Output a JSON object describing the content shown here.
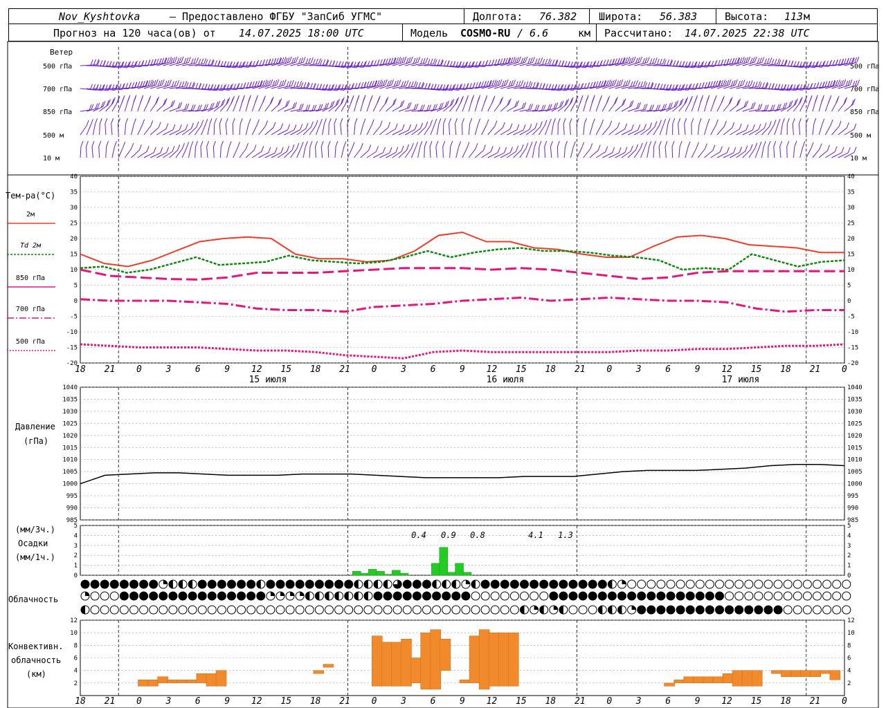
{
  "header": {
    "station": "Nov_Kyshtovka",
    "provider": "— Предоставлено ФГБУ \"ЗапСиб УГМС\"",
    "lon_label": "Долгота:",
    "lon": "76.382",
    "lat_label": "Широта:",
    "lat": "56.383",
    "alt_label": "Высота:",
    "alt": "113",
    "alt_unit": "м",
    "forecast_label": "Прогноз на 120 часа(ов) от",
    "forecast_time": "14.07.2025 18:00 UTC",
    "model_label": "Модель",
    "model": "COSMO-RU",
    "model_res": "/ 6.6",
    "model_res_unit": "км",
    "calc_label": "Рассчитано:",
    "calc_time": "14.07.2025 22:38 UTC"
  },
  "labels": {
    "wind_title": "Ветер",
    "wind_levels": [
      "500 гПа",
      "700 гПа",
      "850 гПа",
      "500 м",
      "10 м"
    ],
    "temp_title": "Тем-ра(°С)",
    "temp_legend": [
      "2м",
      "Td 2м",
      "850 гПа",
      "700 гПа",
      "500 гПа"
    ],
    "pressure_title": [
      "Давление",
      "(гПа)"
    ],
    "precip_title": [
      "(мм/3ч.)",
      "Осадки",
      "(мм/1ч.)"
    ],
    "cloud_title": "Облачность",
    "conv_title": [
      "Конвективн.",
      "облачность",
      "(км)"
    ],
    "day_labels": [
      "15 июля",
      "16 июля",
      "17 июля"
    ]
  },
  "chart_data": [
    {
      "type": "line",
      "title": "Тем-ра(°С)",
      "x_ticks": [
        "18",
        "21",
        "0",
        "3",
        "6",
        "9",
        "12",
        "15",
        "18",
        "21",
        "0",
        "3",
        "6",
        "9",
        "12",
        "15",
        "18",
        "21",
        "0",
        "3",
        "6",
        "9",
        "12",
        "15",
        "18",
        "21",
        "0"
      ],
      "ylim": [
        -20,
        40
      ],
      "yticks": [
        -20,
        -15,
        -10,
        -5,
        0,
        5,
        10,
        15,
        20,
        25,
        30,
        35,
        40
      ],
      "x_hours": [
        0,
        3,
        6,
        9,
        12,
        15,
        18,
        21,
        24,
        27,
        30,
        33,
        36,
        39,
        42,
        45,
        48,
        51,
        54,
        57,
        60,
        63,
        66,
        69,
        72,
        75,
        78
      ],
      "series": [
        {
          "name": "2м",
          "color": "#f03c28",
          "values": [
            15,
            12,
            11,
            13,
            16,
            19,
            20,
            20.5,
            20,
            15,
            13.5,
            13.5,
            12.5,
            13,
            16,
            21,
            22,
            19,
            19,
            17,
            16.5,
            15,
            14,
            14,
            17.5,
            20.5,
            21,
            20,
            18,
            17.5,
            17,
            15.5,
            15.5
          ]
        },
        {
          "name": "Td 2м",
          "color": "#0a8a0a",
          "values": [
            10.5,
            11,
            9,
            10,
            12,
            14,
            11.5,
            12,
            12.5,
            14.5,
            13,
            12.5,
            12,
            12.5,
            14,
            16,
            14,
            15.5,
            16.5,
            17,
            16,
            16,
            15.5,
            14.5,
            14,
            13,
            10,
            10.5,
            10,
            15,
            13,
            11,
            12.5,
            13
          ]
        },
        {
          "name": "850 гПа",
          "color": "#e6157e",
          "values": [
            10,
            8,
            7.5,
            7,
            6.8,
            7.5,
            9,
            9,
            9,
            9.5,
            10,
            10.5,
            10.5,
            10.5,
            10,
            10.5,
            10,
            9,
            8,
            7,
            7.5,
            9,
            9.5,
            9.5,
            9.5,
            9.5,
            9.5
          ]
        },
        {
          "name": "700 гПа",
          "color": "#e6157e",
          "values": [
            0.5,
            0,
            0,
            0,
            -0.5,
            -1,
            -2.5,
            -3,
            -3,
            -3.5,
            -2,
            -1.5,
            -1,
            0,
            0.5,
            1,
            0,
            0.5,
            1,
            0.5,
            0,
            0,
            -0.5,
            -2.5,
            -3.5,
            -3,
            -3
          ]
        },
        {
          "name": "500 гПа",
          "color": "#e6157e",
          "values": [
            -14,
            -14.5,
            -15,
            -15,
            -15,
            -15.5,
            -16,
            -16,
            -16.5,
            -17.5,
            -18,
            -18.5,
            -16.5,
            -16,
            -16.5,
            -16.5,
            -16.5,
            -16.5,
            -16.5,
            -16,
            -16,
            -15.5,
            -15.5,
            -15,
            -14.5,
            -14.5,
            -14
          ]
        }
      ]
    },
    {
      "type": "line",
      "title": "Давление (гПа)",
      "ylim": [
        985,
        1040
      ],
      "yticks": [
        985,
        990,
        995,
        1000,
        1005,
        1010,
        1015,
        1020,
        1025,
        1030,
        1035,
        1040
      ],
      "series": [
        {
          "name": "pressure",
          "color": "#000000",
          "values": [
            1000,
            1003.5,
            1004,
            1004.5,
            1004.5,
            1004,
            1003.5,
            1003.5,
            1003.5,
            1004,
            1004,
            1004,
            1003.5,
            1003,
            1002.5,
            1002.5,
            1002.5,
            1002.5,
            1003,
            1003,
            1003,
            1004,
            1005,
            1005.5,
            1005.5,
            1005.5,
            1006,
            1006.5,
            1007.5,
            1008,
            1008,
            1007.5
          ]
        }
      ]
    },
    {
      "type": "bar",
      "title": "Осадки",
      "ylim": [
        0,
        5
      ],
      "yticks": [
        0,
        1,
        2,
        3,
        4,
        5
      ],
      "bars_hour": [
        35,
        36,
        37,
        38,
        39,
        40,
        41,
        42,
        43,
        44,
        45,
        46,
        47,
        48,
        49
      ],
      "values": [
        0.4,
        0.2,
        0.6,
        0.4,
        0.1,
        0.5,
        0.2,
        0,
        0,
        0,
        1.2,
        2.8,
        0.3,
        1.2,
        0.3
      ],
      "sum_labels": [
        "0.4",
        "0.9",
        "0.8",
        "4.1",
        "1.3"
      ],
      "color": "#22cc22"
    },
    {
      "type": "bar",
      "title": "Конвективн. облачность (км)",
      "ylim": [
        0,
        12
      ],
      "yticks": [
        2,
        4,
        6,
        8,
        10,
        12
      ],
      "color": "#f08a2c",
      "segments": [
        {
          "h": 6,
          "base": 1.5,
          "top": 2.5
        },
        {
          "h": 7,
          "base": 1.5,
          "top": 2.5
        },
        {
          "h": 8,
          "base": 2,
          "top": 3
        },
        {
          "h": 9,
          "base": 2,
          "top": 2.5
        },
        {
          "h": 10,
          "base": 2,
          "top": 2.5
        },
        {
          "h": 11,
          "base": 2,
          "top": 2.5
        },
        {
          "h": 12,
          "base": 2,
          "top": 3.5
        },
        {
          "h": 13,
          "base": 1.5,
          "top": 3.5
        },
        {
          "h": 14,
          "base": 1.5,
          "top": 4
        },
        {
          "h": 24,
          "base": 3.5,
          "top": 4
        },
        {
          "h": 25,
          "base": 4.5,
          "top": 5
        },
        {
          "h": 30,
          "base": 1.5,
          "top": 9.5
        },
        {
          "h": 31,
          "base": 1.5,
          "top": 8.5
        },
        {
          "h": 32,
          "base": 1.5,
          "top": 8.5
        },
        {
          "h": 33,
          "base": 1.5,
          "top": 9
        },
        {
          "h": 34,
          "base": 2,
          "top": 6
        },
        {
          "h": 35,
          "base": 1,
          "top": 10
        },
        {
          "h": 36,
          "base": 1,
          "top": 10.5
        },
        {
          "h": 37,
          "base": 4,
          "top": 9
        },
        {
          "h": 39,
          "base": 2,
          "top": 2.5
        },
        {
          "h": 40,
          "base": 2,
          "top": 9.5
        },
        {
          "h": 41,
          "base": 1,
          "top": 10.5
        },
        {
          "h": 42,
          "base": 1.5,
          "top": 10
        },
        {
          "h": 43,
          "base": 1.5,
          "top": 10
        },
        {
          "h": 44,
          "base": 1.5,
          "top": 10
        },
        {
          "h": 60,
          "base": 1.5,
          "top": 2
        },
        {
          "h": 61,
          "base": 2,
          "top": 2.5
        },
        {
          "h": 62,
          "base": 2,
          "top": 3
        },
        {
          "h": 63,
          "base": 2,
          "top": 3
        },
        {
          "h": 64,
          "base": 2,
          "top": 3
        },
        {
          "h": 65,
          "base": 2,
          "top": 3
        },
        {
          "h": 66,
          "base": 2,
          "top": 3.5
        },
        {
          "h": 67,
          "base": 1.5,
          "top": 4
        },
        {
          "h": 68,
          "base": 1.5,
          "top": 4
        },
        {
          "h": 69,
          "base": 1.5,
          "top": 4
        },
        {
          "h": 71,
          "base": 3.5,
          "top": 4
        },
        {
          "h": 72,
          "base": 3,
          "top": 4
        },
        {
          "h": 73,
          "base": 3,
          "top": 4
        },
        {
          "h": 74,
          "base": 3,
          "top": 4
        },
        {
          "h": 75,
          "base": 3,
          "top": 4
        },
        {
          "h": 76,
          "base": 3.5,
          "top": 4
        },
        {
          "h": 77,
          "base": 2.5,
          "top": 4
        }
      ]
    }
  ],
  "clouds": {
    "rows": [
      "FFFFFFFFQHHHFFFFFFHFFFFFFFFFHHHHTFFFHHHQHFFFFFFFFFFFFFHQEEEEEEEEEEEEEEEEEEEEEEEEEEEEEEEEEEEEEEEEEEEEEEEEEEEEEE",
      "QEEEFFFFFFFFFFFFFFFQQQQHHHHHHHFFFFFFFFFFEEEEEEEEFFFFFFFFFFFFFFFFFFEEEEEEEEEEEEEEEEEEEEEEEEQQQQQHHHFFFFFFFFFFFFFFFFFFFFFFFFFFFFFFFFFFF",
      "HEEEEEEEEEEEEEEEEEEEEEEEEEEEEEEEEEEEEEEEEEEEEHQHQHEEEHHHQFFFFFFFFFFFFFFFEEEEEEEEEEEEEEEEEEEEEEEEEEEEEEEEEEEE"
    ]
  },
  "wind": {
    "levels": 5,
    "color": "#6a1fc8"
  }
}
